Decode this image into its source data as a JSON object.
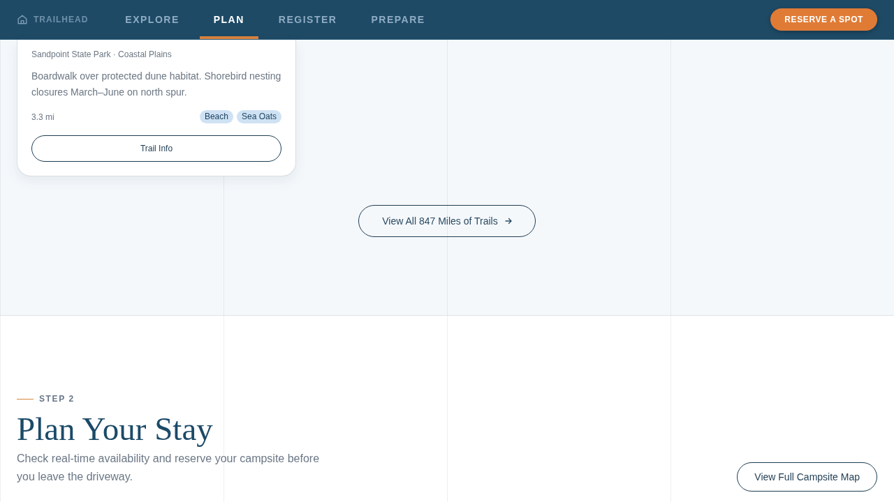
{
  "nav": {
    "brand": "TRAILHEAD",
    "items": [
      {
        "label": "EXPLORE",
        "selected": false
      },
      {
        "label": "PLAN",
        "selected": true
      },
      {
        "label": "REGISTER",
        "selected": false
      },
      {
        "label": "PREPARE",
        "selected": false
      }
    ],
    "action": "RESERVE A SPOT"
  },
  "trail_card": {
    "location": "Sandpoint State Park · Coastal Plains",
    "description": "Boardwalk over protected dune habitat. Shorebird nesting closures March–June on north spur.",
    "distance": "3.3 mi",
    "tags": [
      "Beach",
      "Sea Oats"
    ],
    "button": "Trail Info"
  },
  "trails_link": "View All 847 Miles of Trails",
  "step": {
    "eyebrow": "STEP 2",
    "title": "Plan Your Stay",
    "intro": "Check real-time availability and reserve your campsite before you leave the driveway.",
    "action": "View Full Campsite Map"
  }
}
